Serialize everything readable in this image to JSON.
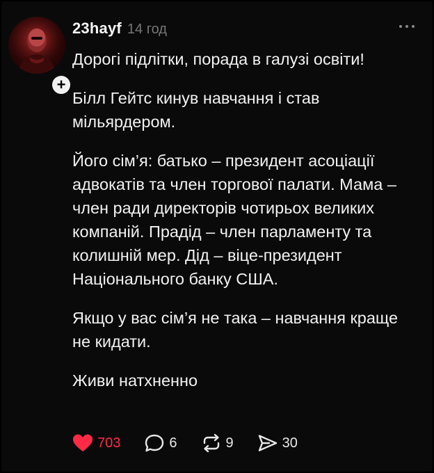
{
  "post": {
    "username": "23hayf",
    "time": "14 год",
    "paragraphs": [
      "Дорогі підлітки, порада в галузі освіти!",
      "Білл Гейтс кинув навчання і став мільярдером.",
      "Його сім’я: батько – президент асоціації адвокатів та член торгової палати. Мама – член ради директорів чотирьох великих компаній. Прадід – член парламенту та колишній мер. Дід – віце-президент Національного банку США.",
      "Якщо у вас сім’я не така – навчання краще не кидати.",
      "Живи натхненно"
    ],
    "follow_symbol": "+"
  },
  "actions": {
    "likes": "703",
    "comments": "6",
    "reposts": "9",
    "shares": "30"
  },
  "colors": {
    "background": "#0a0a0a",
    "text": "#f2f2f2",
    "muted": "#777777",
    "like": "#ff2b46"
  },
  "icons": {
    "avatar": "profile-photo",
    "follow": "plus-icon",
    "more": "more-horizontal-icon",
    "like": "heart-filled-icon",
    "comment": "comment-bubble-icon",
    "repost": "repost-arrows-icon",
    "share": "send-paper-plane-icon"
  }
}
